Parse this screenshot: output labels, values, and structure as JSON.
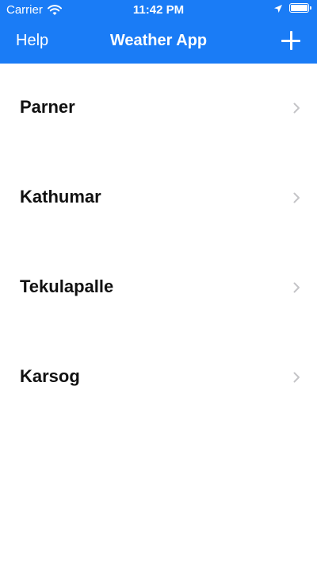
{
  "status_bar": {
    "carrier": "Carrier",
    "time": "11:42 PM",
    "icons": [
      "wifi-icon",
      "location-icon",
      "battery-icon"
    ]
  },
  "nav": {
    "left_button": "Help",
    "title": "Weather App",
    "right_button_icon": "plus-icon"
  },
  "cities": [
    {
      "name": "Parner"
    },
    {
      "name": "Kathumar"
    },
    {
      "name": "Tekulapalle"
    },
    {
      "name": "Karsog"
    }
  ],
  "colors": {
    "header_bg": "#1a7cf6",
    "header_text": "#ffffff",
    "list_text": "#111111",
    "chevron": "#c4c4c7",
    "background": "#ffffff"
  }
}
